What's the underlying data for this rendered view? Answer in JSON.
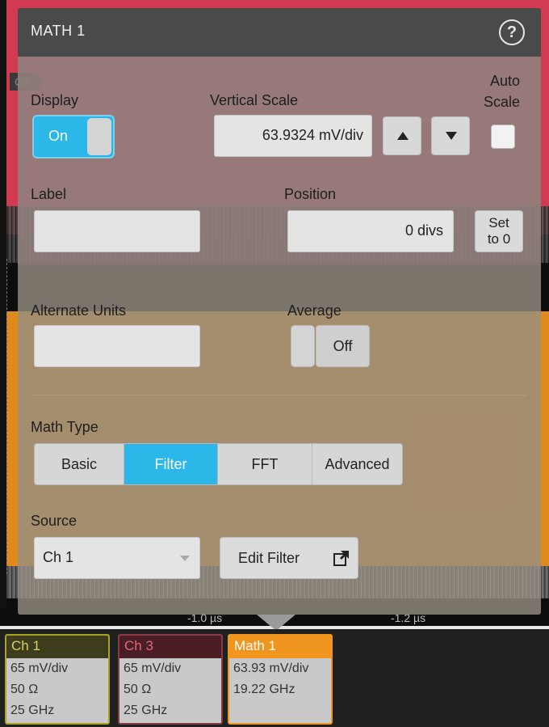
{
  "scope": {
    "marker": "C3",
    "time_labels": [
      "-1.0 µs",
      "-1.2 µs"
    ]
  },
  "dialog": {
    "title": "MATH 1",
    "help_icon": "?",
    "display": {
      "label": "Display",
      "state": "On"
    },
    "vertical_scale": {
      "label": "Vertical Scale",
      "value": "63.9324 mV/div"
    },
    "auto_scale": {
      "label_line1": "Auto",
      "label_line2": "Scale"
    },
    "label_field": {
      "label": "Label",
      "value": ""
    },
    "position": {
      "label": "Position",
      "value": "0 divs",
      "set_line1": "Set",
      "set_line2": "to 0"
    },
    "alternate_units": {
      "label": "Alternate Units",
      "value": ""
    },
    "average": {
      "label": "Average",
      "state": "Off"
    },
    "math_type": {
      "label": "Math Type",
      "options": [
        "Basic",
        "Filter",
        "FFT",
        "Advanced"
      ],
      "selected": "Filter"
    },
    "source": {
      "label": "Source",
      "value": "Ch 1"
    },
    "edit_filter_label": "Edit Filter"
  },
  "badges": [
    {
      "name": "Ch 1",
      "scale": "65 mV/div",
      "impedance": "50 Ω",
      "bandwidth": "25 GHz",
      "color": "#a8a21e",
      "header_bg": "#3d3d1e"
    },
    {
      "name": "Ch 3",
      "scale": "65 mV/div",
      "impedance": "50 Ω",
      "bandwidth": "25 GHz",
      "color": "#c94a5a",
      "header_bg": "#4a1e24"
    },
    {
      "name": "Math 1",
      "scale": "63.93 mV/div",
      "bandwidth": "19.22 GHz",
      "color": "#f0961e",
      "header_bg": "#f0961e"
    }
  ]
}
